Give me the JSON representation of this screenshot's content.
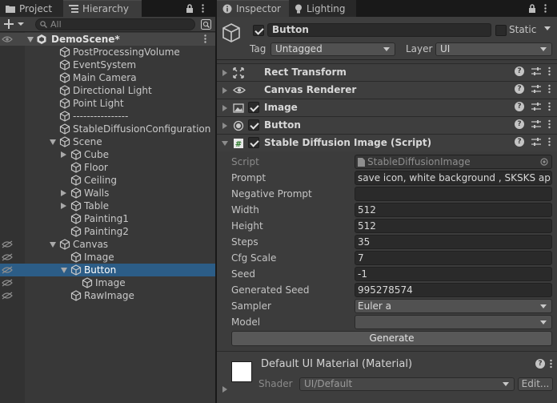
{
  "left_panel": {
    "tabs": [
      {
        "label": "Project",
        "icon": "folder-icon"
      },
      {
        "label": "Hierarchy",
        "icon": "list-icon"
      }
    ],
    "search_placeholder": "All",
    "tree": [
      {
        "label": "DemoScene*",
        "type": "scene"
      },
      {
        "label": "PostProcessingVolume"
      },
      {
        "label": "EventSystem"
      },
      {
        "label": "Main Camera"
      },
      {
        "label": "Directional Light"
      },
      {
        "label": "Point Light"
      },
      {
        "label": "----------------"
      },
      {
        "label": "StableDiffusionConfiguration"
      },
      {
        "label": "Scene"
      },
      {
        "label": "Cube"
      },
      {
        "label": "Floor"
      },
      {
        "label": "Ceiling"
      },
      {
        "label": "Walls"
      },
      {
        "label": "Table"
      },
      {
        "label": "Painting1"
      },
      {
        "label": "Painting2"
      },
      {
        "label": "Canvas"
      },
      {
        "label": "Image"
      },
      {
        "label": "Button"
      },
      {
        "label": "Image"
      },
      {
        "label": "RawImage"
      }
    ]
  },
  "inspector": {
    "tabs": [
      {
        "label": "Inspector",
        "icon": "info-icon"
      },
      {
        "label": "Lighting",
        "icon": "bulb-icon"
      }
    ],
    "object_name": "Button",
    "static_label": "Static",
    "tag_label": "Tag",
    "tag_value": "Untagged",
    "layer_label": "Layer",
    "layer_value": "UI",
    "components": [
      {
        "title": "Rect Transform"
      },
      {
        "title": "Canvas Renderer"
      },
      {
        "title": "Image"
      },
      {
        "title": "Button"
      },
      {
        "title": "Stable Diffusion Image (Script)"
      }
    ],
    "script_props": {
      "script_label": "Script",
      "script_value": "StableDiffusionImage",
      "prompt_label": "Prompt",
      "prompt_value": "save icon, white background , SKSKS app ic",
      "negative_prompt_label": "Negative Prompt",
      "negative_prompt_value": "",
      "width_label": "Width",
      "width_value": "512",
      "height_label": "Height",
      "height_value": "512",
      "steps_label": "Steps",
      "steps_value": "35",
      "cfg_label": "Cfg Scale",
      "cfg_value": "7",
      "seed_label": "Seed",
      "seed_value": "-1",
      "gen_seed_label": "Generated Seed",
      "gen_seed_value": "995278574",
      "sampler_label": "Sampler",
      "sampler_value": "Euler a",
      "model_label": "Model",
      "model_value": "",
      "generate_label": "Generate"
    },
    "material": {
      "name": "Default UI Material (Material)",
      "shader_label": "Shader",
      "shader_value": "UI/Default",
      "edit_label": "Edit..."
    }
  },
  "colors": {
    "selection": "#2c5d87",
    "panel": "#383838",
    "field": "#2a2a2a"
  }
}
